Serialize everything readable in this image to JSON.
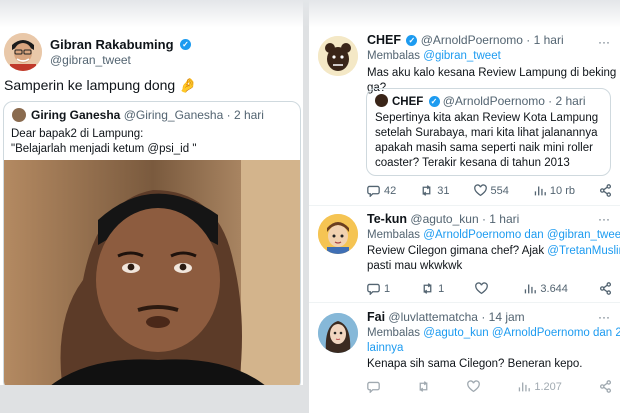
{
  "left_tweet": {
    "author_name": "Gibran Rakabuming",
    "author_handle": "@gibran_tweet",
    "text": "Samperin ke lampung dong",
    "emoji": "🤌",
    "quote": {
      "author_name": "Giring Ganesha",
      "author_handle": "@Giring_Ganesha",
      "time": "· 2 hari",
      "line1": "Dear bapak2 di Lampung:",
      "line2": "\"Belajarlah menjadi ketum @psi_id \""
    }
  },
  "reply_chef": {
    "author_name": "CHEF",
    "author_handle": "@ArnoldPoernomo",
    "time": "· 1 hari",
    "replying_prefix": "Membalas",
    "replying_to": "@gibran_tweet",
    "text": "Mas aku kalo kesana Review Lampung di beking ga?",
    "quote": {
      "author_name": "CHEF",
      "author_handle": "@ArnoldPoernomo",
      "time": "· 2 hari",
      "line1": "Sepertinya kita akan Review Kota Lampung",
      "line2": "setelah Surabaya, mari kita lihat jalanannya",
      "line3": "apakah masih sama seperti naik mini roller",
      "line4": "coaster? Terakir kesana di tahun 2013"
    },
    "stats": {
      "replies": "42",
      "retweets": "31",
      "likes": "554",
      "views": "10 rb"
    }
  },
  "reply_tekun": {
    "author_name": "Te-kun",
    "author_handle": "@aguto_kun",
    "time": "· 1 hari",
    "replying_prefix": "Membalas",
    "replying_to": "@ArnoldPoernomo dan @gibran_tweet",
    "text_a": "Review Cilegon gimana chef? Ajak",
    "text_mention": "@TretanMuslim",
    "text_b": "pasti mau wkwkwk",
    "stats": {
      "replies": "1",
      "retweets": "1",
      "likes": "",
      "views": "3.644"
    }
  },
  "reply_fai": {
    "author_name": "Fai",
    "author_handle": "@luvlattematcha",
    "time": "· 14 jam",
    "replying_prefix": "Membalas",
    "replying_line1": "@aguto_kun @ArnoldPoernomo dan 2",
    "replying_line2": "lainnya",
    "text": "Kenapa sih sama Cilegon? Beneran kepo.",
    "stats": {
      "views": "1.207"
    }
  },
  "colors": {
    "accent": "#1d9bf0",
    "muted": "#536471"
  }
}
